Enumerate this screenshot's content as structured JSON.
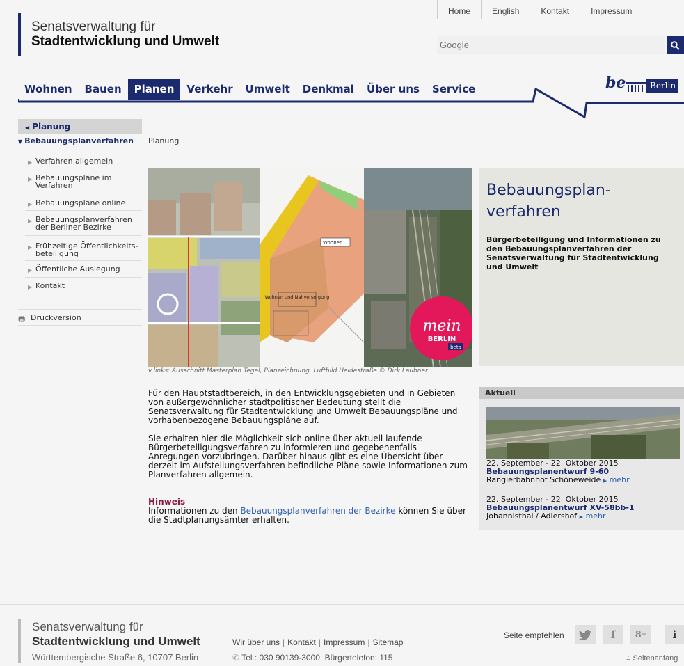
{
  "header": {
    "org_line1": "Senatsverwaltung für",
    "org_line2": "Stadtentwicklung und Umwelt",
    "top_links": [
      "Home",
      "English",
      "Kontakt",
      "Impressum"
    ],
    "search_placeholder": "Google",
    "nav": [
      "Wohnen",
      "Bauen",
      "Planen",
      "Verkehr",
      "Umwelt",
      "Denkmal",
      "Über uns",
      "Service"
    ],
    "active_nav": "Planen",
    "brand_be": "be",
    "brand_berlin": "Berlin",
    "brand_color": "#1c2a6e"
  },
  "sidebar": {
    "parent": "Planung",
    "current": "Bebauungsplanverfahren",
    "items": [
      "Verfahren allgemein",
      "Bebauungspläne im Verfahren",
      "Bebauungspläne online",
      "Bebauungsplanverfahren der Berliner Bezirke",
      "Frühzeitige Öffentlichkeits-beteiligung",
      "Öffentliche Auslegung",
      "Kontakt"
    ],
    "print": "Druckversion"
  },
  "breadcrumb": "Planung",
  "teaser": {
    "plan_label_wohnen": "Wohnen",
    "plan_label_wohnen_nv": "Wohnen und Nahversorgung",
    "mein_berlin_1": "mein",
    "mein_berlin_2": "BERLIN",
    "mein_berlin_3": "beta",
    "caption": "v.links: Ausschnitt Masterplan Tegel, Planzeichnung, Luftbild Heidestraße © Dirk Laubner"
  },
  "title_box": {
    "title": "Bebauungsplan-verfahren",
    "subtitle": "Bürgerbeteiligung und Informationen zu den Bebauungsplanverfahren der Senatsverwaltung für Stadtentwicklung und Umwelt"
  },
  "body": {
    "p1": "Für den Hauptstadtbereich, in den Entwicklungsgebieten und in Gebieten von außergewöhnlicher stadtpolitischer Bedeutung stellt die Senatsverwaltung für Stadtentwicklung und Umwelt Bebauungspläne und vorhabenbezogene Bebauungspläne auf.",
    "p2": "Sie erhalten hier die Möglichkeit sich online über aktuell laufende Bürgerbeteiligungsverfahren zu informieren und gegebenenfalls Anregungen vorzubringen. Darüber hinaus gibt es eine Übersicht über derzeit im Aufstellungsverfahren befindliche Pläne sowie Informationen zum Planverfahren allgemein.",
    "hinweis_label": "Hinweis",
    "hinweis_pre": "Informationen zu den ",
    "hinweis_link": "Bebauungsplanverfahren der Bezirke",
    "hinweis_post": " können Sie über die Stadtplanungsämter erhalten."
  },
  "aktuell": {
    "heading": "Aktuell",
    "news": [
      {
        "date": "22. September - 22. Oktober 2015",
        "title": "Bebauungsplanentwurf 9-60",
        "place": "Rangierbahnhof Schöneweide",
        "more": "mehr"
      },
      {
        "date": "22. September - 22. Oktober 2015",
        "title": "Bebauungsplanentwurf XV-58bb-1",
        "place": "Johannisthal / Adlershof",
        "more": "mehr"
      }
    ]
  },
  "footer": {
    "org_line1": "Senatsverwaltung für",
    "org_line2": "Stadtentwicklung und Umwelt",
    "address": "Württembergische Straße 6, 10707 Berlin",
    "links": [
      "Wir über uns",
      "Kontakt",
      "Impressum",
      "Sitemap"
    ],
    "tel": "Tel.: 030 90139-3000",
    "buergertelefon": "Bürgertelefon: 115",
    "recommend": "Seite empfehlen",
    "top": "Seitenanfang"
  }
}
